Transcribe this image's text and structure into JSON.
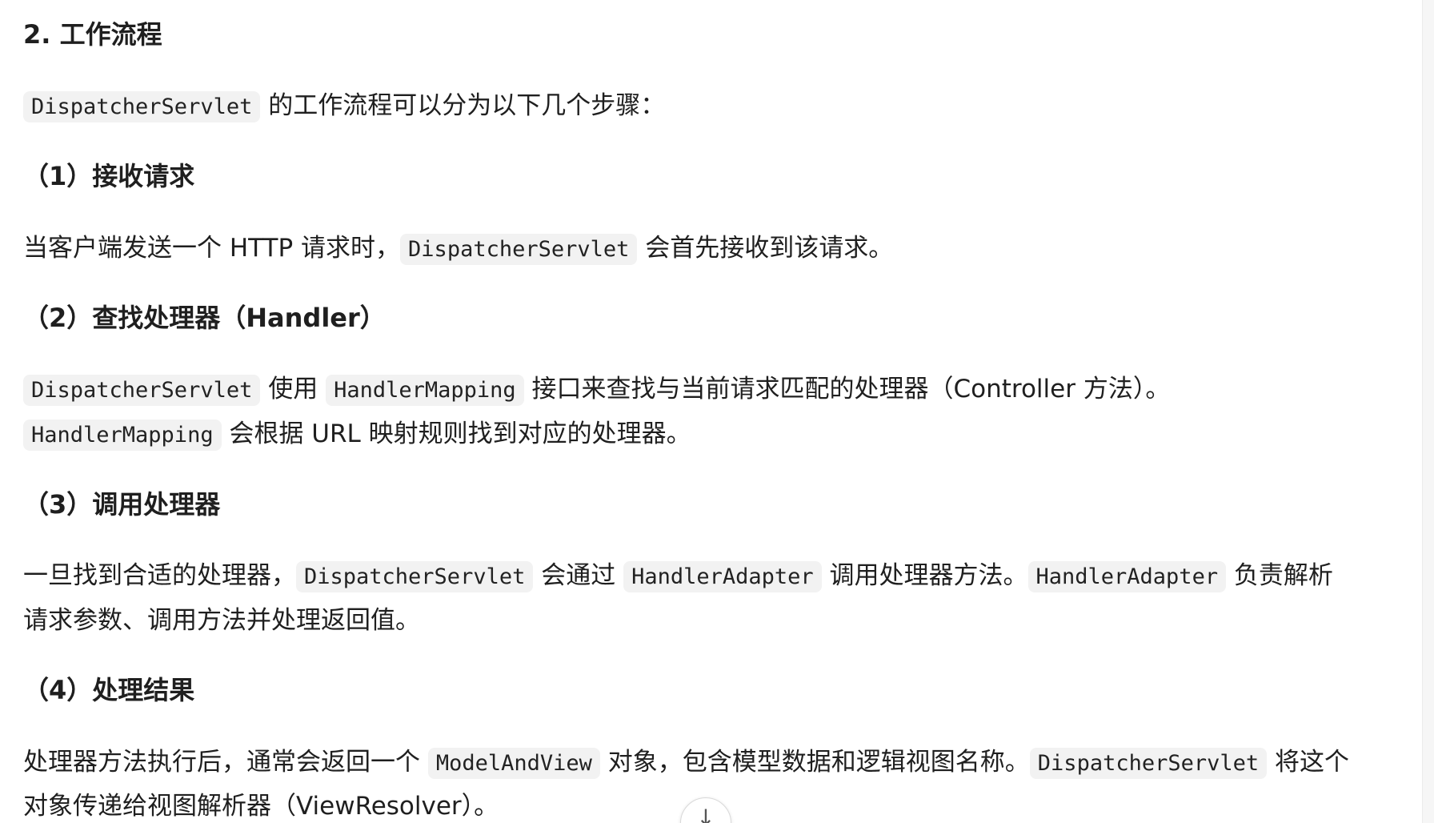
{
  "section_title": "2. 工作流程",
  "intro": {
    "code1": "DispatcherServlet",
    "text1": " 的工作流程可以分为以下几个步骤："
  },
  "step1": {
    "heading": "（1）接收请求",
    "text1": "当客户端发送一个 HTTP 请求时，",
    "code1": "DispatcherServlet",
    "text2": " 会首先接收到该请求。"
  },
  "step2": {
    "heading": "（2）查找处理器（Handler）",
    "line1_code1": "DispatcherServlet",
    "line1_text1": " 使用 ",
    "line1_code2": "HandlerMapping",
    "line1_text2": " 接口来查找与当前请求匹配的处理器（Controller 方法）。",
    "line2_code1": "HandlerMapping",
    "line2_text1": " 会根据 URL 映射规则找到对应的处理器。"
  },
  "step3": {
    "heading": "（3）调用处理器",
    "line1_text1": "一旦找到合适的处理器，",
    "line1_code1": "DispatcherServlet",
    "line1_text2": " 会通过 ",
    "line1_code2": "HandlerAdapter",
    "line1_text3": " 调用处理器方法。",
    "line1_code3": "HandlerAdapter",
    "line1_text4": " 负责解析",
    "line2_text1": "请求参数、调用方法并处理返回值。"
  },
  "step4": {
    "heading": "（4）处理结果",
    "line1_text1": "处理器方法执行后，通常会返回一个 ",
    "line1_code1": "ModelAndView",
    "line1_text2": " 对象，包含模型数据和逻辑视图名称。",
    "line1_code2": "DispatcherServlet",
    "line1_text3": " 将这个",
    "line2_text1": "对象传递给视图解析器（ViewResolver）。"
  },
  "scroll_button": {
    "icon": "arrow-down-icon",
    "glyph": "↓"
  }
}
